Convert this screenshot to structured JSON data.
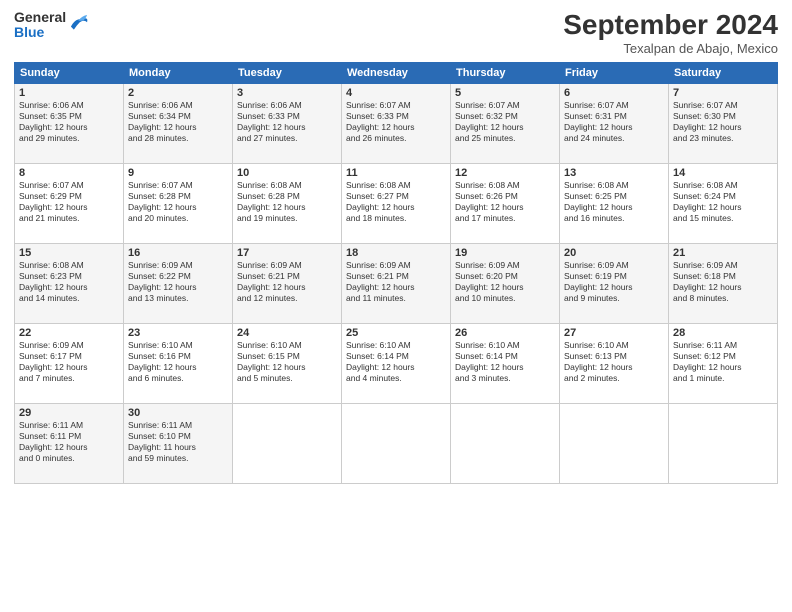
{
  "header": {
    "logo": {
      "general": "General",
      "blue": "Blue"
    },
    "title": "September 2024",
    "location": "Texalpan de Abajo, Mexico"
  },
  "columns": [
    "Sunday",
    "Monday",
    "Tuesday",
    "Wednesday",
    "Thursday",
    "Friday",
    "Saturday"
  ],
  "weeks": [
    [
      {
        "day": "1",
        "lines": [
          "Sunrise: 6:06 AM",
          "Sunset: 6:35 PM",
          "Daylight: 12 hours",
          "and 29 minutes."
        ]
      },
      {
        "day": "2",
        "lines": [
          "Sunrise: 6:06 AM",
          "Sunset: 6:34 PM",
          "Daylight: 12 hours",
          "and 28 minutes."
        ]
      },
      {
        "day": "3",
        "lines": [
          "Sunrise: 6:06 AM",
          "Sunset: 6:33 PM",
          "Daylight: 12 hours",
          "and 27 minutes."
        ]
      },
      {
        "day": "4",
        "lines": [
          "Sunrise: 6:07 AM",
          "Sunset: 6:33 PM",
          "Daylight: 12 hours",
          "and 26 minutes."
        ]
      },
      {
        "day": "5",
        "lines": [
          "Sunrise: 6:07 AM",
          "Sunset: 6:32 PM",
          "Daylight: 12 hours",
          "and 25 minutes."
        ]
      },
      {
        "day": "6",
        "lines": [
          "Sunrise: 6:07 AM",
          "Sunset: 6:31 PM",
          "Daylight: 12 hours",
          "and 24 minutes."
        ]
      },
      {
        "day": "7",
        "lines": [
          "Sunrise: 6:07 AM",
          "Sunset: 6:30 PM",
          "Daylight: 12 hours",
          "and 23 minutes."
        ]
      }
    ],
    [
      {
        "day": "8",
        "lines": [
          "Sunrise: 6:07 AM",
          "Sunset: 6:29 PM",
          "Daylight: 12 hours",
          "and 21 minutes."
        ]
      },
      {
        "day": "9",
        "lines": [
          "Sunrise: 6:07 AM",
          "Sunset: 6:28 PM",
          "Daylight: 12 hours",
          "and 20 minutes."
        ]
      },
      {
        "day": "10",
        "lines": [
          "Sunrise: 6:08 AM",
          "Sunset: 6:28 PM",
          "Daylight: 12 hours",
          "and 19 minutes."
        ]
      },
      {
        "day": "11",
        "lines": [
          "Sunrise: 6:08 AM",
          "Sunset: 6:27 PM",
          "Daylight: 12 hours",
          "and 18 minutes."
        ]
      },
      {
        "day": "12",
        "lines": [
          "Sunrise: 6:08 AM",
          "Sunset: 6:26 PM",
          "Daylight: 12 hours",
          "and 17 minutes."
        ]
      },
      {
        "day": "13",
        "lines": [
          "Sunrise: 6:08 AM",
          "Sunset: 6:25 PM",
          "Daylight: 12 hours",
          "and 16 minutes."
        ]
      },
      {
        "day": "14",
        "lines": [
          "Sunrise: 6:08 AM",
          "Sunset: 6:24 PM",
          "Daylight: 12 hours",
          "and 15 minutes."
        ]
      }
    ],
    [
      {
        "day": "15",
        "lines": [
          "Sunrise: 6:08 AM",
          "Sunset: 6:23 PM",
          "Daylight: 12 hours",
          "and 14 minutes."
        ]
      },
      {
        "day": "16",
        "lines": [
          "Sunrise: 6:09 AM",
          "Sunset: 6:22 PM",
          "Daylight: 12 hours",
          "and 13 minutes."
        ]
      },
      {
        "day": "17",
        "lines": [
          "Sunrise: 6:09 AM",
          "Sunset: 6:21 PM",
          "Daylight: 12 hours",
          "and 12 minutes."
        ]
      },
      {
        "day": "18",
        "lines": [
          "Sunrise: 6:09 AM",
          "Sunset: 6:21 PM",
          "Daylight: 12 hours",
          "and 11 minutes."
        ]
      },
      {
        "day": "19",
        "lines": [
          "Sunrise: 6:09 AM",
          "Sunset: 6:20 PM",
          "Daylight: 12 hours",
          "and 10 minutes."
        ]
      },
      {
        "day": "20",
        "lines": [
          "Sunrise: 6:09 AM",
          "Sunset: 6:19 PM",
          "Daylight: 12 hours",
          "and 9 minutes."
        ]
      },
      {
        "day": "21",
        "lines": [
          "Sunrise: 6:09 AM",
          "Sunset: 6:18 PM",
          "Daylight: 12 hours",
          "and 8 minutes."
        ]
      }
    ],
    [
      {
        "day": "22",
        "lines": [
          "Sunrise: 6:09 AM",
          "Sunset: 6:17 PM",
          "Daylight: 12 hours",
          "and 7 minutes."
        ]
      },
      {
        "day": "23",
        "lines": [
          "Sunrise: 6:10 AM",
          "Sunset: 6:16 PM",
          "Daylight: 12 hours",
          "and 6 minutes."
        ]
      },
      {
        "day": "24",
        "lines": [
          "Sunrise: 6:10 AM",
          "Sunset: 6:15 PM",
          "Daylight: 12 hours",
          "and 5 minutes."
        ]
      },
      {
        "day": "25",
        "lines": [
          "Sunrise: 6:10 AM",
          "Sunset: 6:14 PM",
          "Daylight: 12 hours",
          "and 4 minutes."
        ]
      },
      {
        "day": "26",
        "lines": [
          "Sunrise: 6:10 AM",
          "Sunset: 6:14 PM",
          "Daylight: 12 hours",
          "and 3 minutes."
        ]
      },
      {
        "day": "27",
        "lines": [
          "Sunrise: 6:10 AM",
          "Sunset: 6:13 PM",
          "Daylight: 12 hours",
          "and 2 minutes."
        ]
      },
      {
        "day": "28",
        "lines": [
          "Sunrise: 6:11 AM",
          "Sunset: 6:12 PM",
          "Daylight: 12 hours",
          "and 1 minute."
        ]
      }
    ],
    [
      {
        "day": "29",
        "lines": [
          "Sunrise: 6:11 AM",
          "Sunset: 6:11 PM",
          "Daylight: 12 hours",
          "and 0 minutes."
        ]
      },
      {
        "day": "30",
        "lines": [
          "Sunrise: 6:11 AM",
          "Sunset: 6:10 PM",
          "Daylight: 11 hours",
          "and 59 minutes."
        ]
      },
      {
        "day": "",
        "lines": []
      },
      {
        "day": "",
        "lines": []
      },
      {
        "day": "",
        "lines": []
      },
      {
        "day": "",
        "lines": []
      },
      {
        "day": "",
        "lines": []
      }
    ]
  ]
}
